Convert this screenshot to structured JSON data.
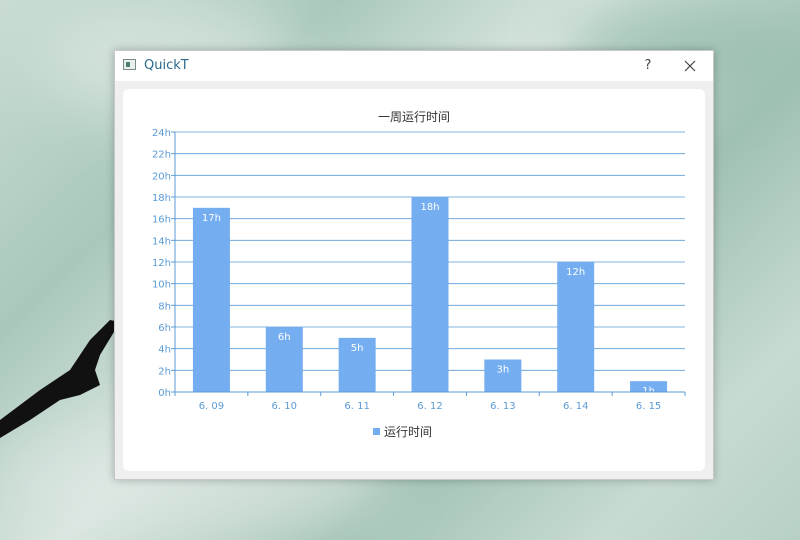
{
  "window": {
    "title": "QuickT",
    "help_label": "?"
  },
  "chart_data": {
    "type": "bar",
    "title": "一周运行时间",
    "categories": [
      "6. 09",
      "6. 10",
      "6. 11",
      "6. 12",
      "6. 13",
      "6. 14",
      "6. 15"
    ],
    "series": [
      {
        "name": "运行时间",
        "values": [
          17,
          6,
          5,
          18,
          3,
          12,
          1
        ]
      }
    ],
    "data_labels": [
      "17h",
      "6h",
      "5h",
      "18h",
      "3h",
      "12h",
      "1h"
    ],
    "y_ticks": [
      "0h",
      "2h",
      "4h",
      "6h",
      "8h",
      "10h",
      "12h",
      "14h",
      "16h",
      "18h",
      "20h",
      "22h",
      "24h"
    ],
    "ylim": [
      0,
      24
    ],
    "grid": true,
    "legend_position": "bottom",
    "colors": {
      "bar": "#74adf0",
      "axis": "#5b9bd5",
      "text": "#333333",
      "label": "#ffffff"
    }
  }
}
